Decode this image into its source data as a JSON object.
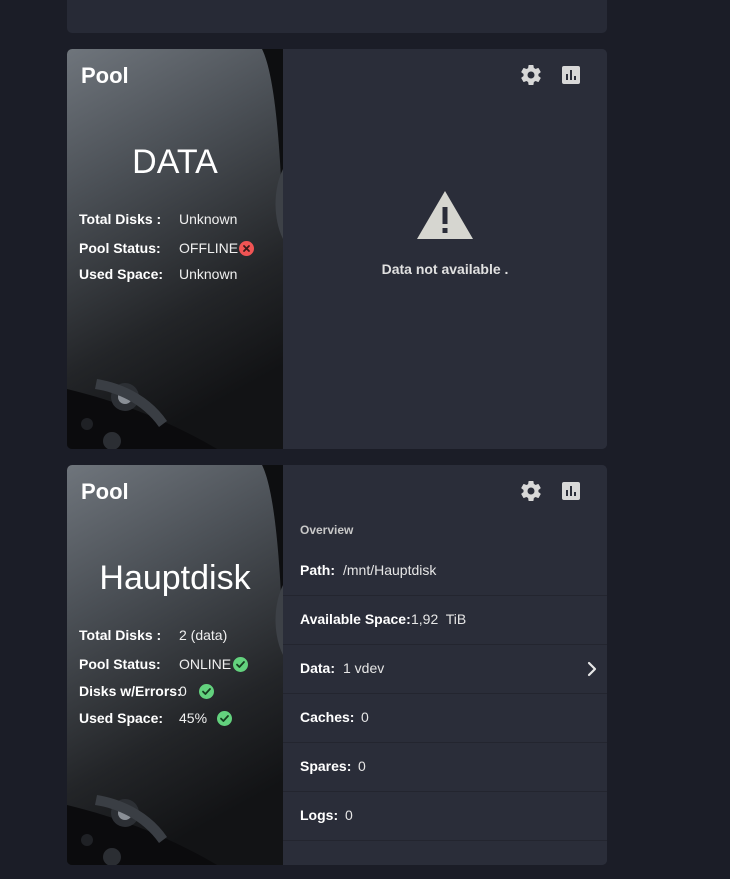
{
  "pools": [
    {
      "label": "Pool",
      "name": "DATA",
      "stats": [
        {
          "key": "Total Disks :",
          "value": "Unknown"
        },
        {
          "key": "Pool Status:",
          "value": "OFFLINE",
          "status": "error"
        },
        {
          "key": "Used Space:",
          "value": "Unknown"
        }
      ],
      "message": "Data not available ."
    },
    {
      "label": "Pool",
      "name": "Hauptdisk",
      "stats": [
        {
          "key": "Total Disks :",
          "value": "2 (data)"
        },
        {
          "key": "Pool Status:",
          "value": "ONLINE",
          "status": "ok"
        },
        {
          "key": "Disks w/Errors:",
          "value": "0",
          "status": "ok"
        },
        {
          "key": "Used Space:",
          "value": "45%",
          "status": "ok"
        }
      ],
      "overview": {
        "title": "Overview",
        "rows": [
          {
            "key": "Path:",
            "value": "/mnt/Hauptdisk"
          },
          {
            "key": "Available Space:",
            "value": "1,92  TiB"
          },
          {
            "key": "Data:",
            "value": "1 vdev",
            "expandable": true
          },
          {
            "key": "Caches:",
            "value": "0"
          },
          {
            "key": "Spares:",
            "value": "0"
          },
          {
            "key": "Logs:",
            "value": "0"
          }
        ]
      }
    }
  ],
  "icons": {
    "settings": "gear-icon",
    "stats": "bar-chart-icon",
    "warning": "warning-icon",
    "expand": "chevron-right-icon"
  },
  "colors": {
    "background": "#1b1d27",
    "card": "#2a2d39",
    "ok": "#63d27e",
    "error": "#f05454"
  }
}
